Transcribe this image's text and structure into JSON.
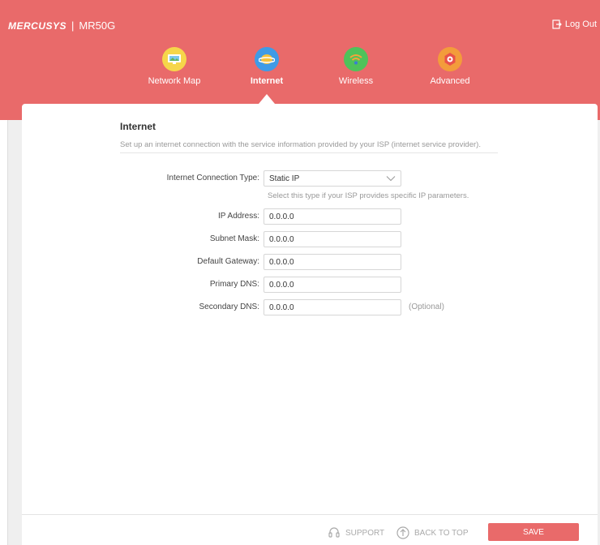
{
  "header": {
    "brand": "MERCUSYS",
    "separator": "|",
    "model": "MR50G",
    "logout_label": "Log Out"
  },
  "nav": {
    "items": [
      {
        "label": "Network Map",
        "icon": "network-map-icon",
        "color": "#f6d64a"
      },
      {
        "label": "Internet",
        "icon": "globe-icon",
        "color": "#3f9be6",
        "active": true
      },
      {
        "label": "Wireless",
        "icon": "wifi-icon",
        "color": "#4fc25a"
      },
      {
        "label": "Advanced",
        "icon": "gear-icon",
        "color": "#f39c3b"
      }
    ]
  },
  "section": {
    "title": "Internet",
    "description": "Set up an internet connection with the service information provided by your ISP (internet service provider)."
  },
  "form": {
    "connection_type": {
      "label": "Internet Connection Type:",
      "value": "Static IP",
      "hint": "Select this type if your ISP provides specific IP parameters."
    },
    "ip_address": {
      "label": "IP Address:",
      "value": "0.0.0.0"
    },
    "subnet_mask": {
      "label": "Subnet Mask:",
      "value": "0.0.0.0"
    },
    "default_gateway": {
      "label": "Default Gateway:",
      "value": "0.0.0.0"
    },
    "primary_dns": {
      "label": "Primary DNS:",
      "value": "0.0.0.0"
    },
    "secondary_dns": {
      "label": "Secondary DNS:",
      "value": "0.0.0.0",
      "note": "(Optional)"
    }
  },
  "footer": {
    "support_label": "SUPPORT",
    "back_to_top_label": "BACK TO TOP",
    "save_label": "SAVE"
  },
  "colors": {
    "accent": "#e96a6a"
  }
}
